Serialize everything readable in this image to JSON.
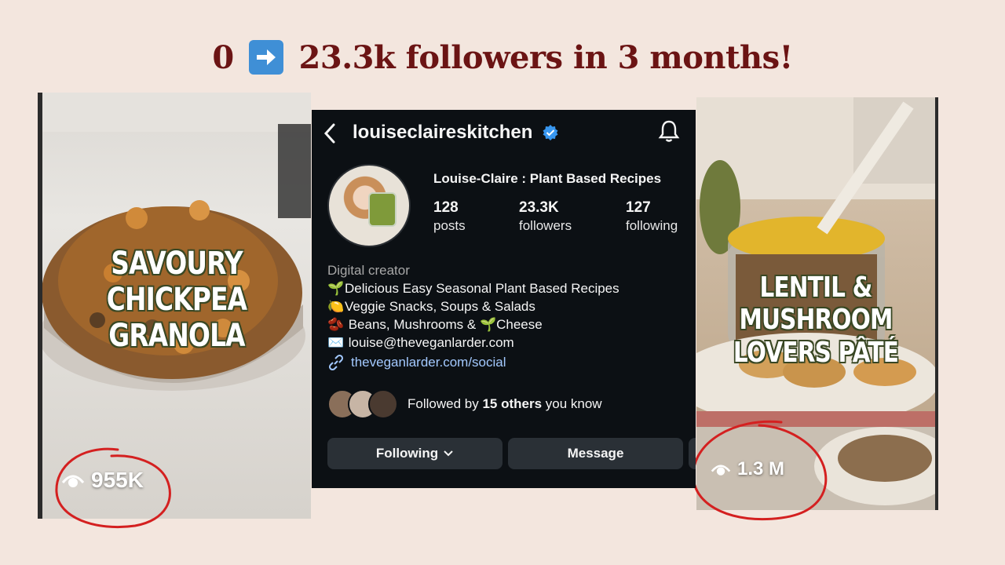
{
  "headline": {
    "prefix": "0",
    "suffix": "23.3k followers in 3 months!"
  },
  "left_card": {
    "title_line1": "SAVOURY",
    "title_line2": "CHICKPEA GRANOLA",
    "views": "955K"
  },
  "right_card": {
    "title_line1": "LENTIL & MUSHROOM",
    "title_line2": "LOVERS PÂTÉ",
    "views": "1.3 M"
  },
  "profile": {
    "handle": "louiseclaireskitchen",
    "display_name": "Louise-Claire : Plant Based Recipes",
    "stats": [
      {
        "value": "128",
        "label": "posts"
      },
      {
        "value": "23.3K",
        "label": "followers"
      },
      {
        "value": "127",
        "label": "following"
      }
    ],
    "category": "Digital creator",
    "bio": [
      {
        "emoji": "🌱",
        "text": "Delicious Easy Seasonal Plant Based Recipes"
      },
      {
        "emoji": "🍋",
        "text": "Veggie Snacks, Soups & Salads"
      },
      {
        "emoji": "🫘",
        "text": " Beans, Mushrooms & 🌱Cheese"
      },
      {
        "emoji": "✉️",
        "text": " louise@theveganlarder.com"
      }
    ],
    "link": "theveganlarder.com/social",
    "followed_by_prefix": "Followed by ",
    "followed_by_count": "15 others",
    "followed_by_suffix": " you know",
    "following_button": "Following",
    "message_button": "Message"
  },
  "colors": {
    "headline": "#6b1414",
    "phone_bg": "#0c1014",
    "verified": "#3897f0",
    "link": "#a3c9ff",
    "annotation_red": "#d42020"
  }
}
